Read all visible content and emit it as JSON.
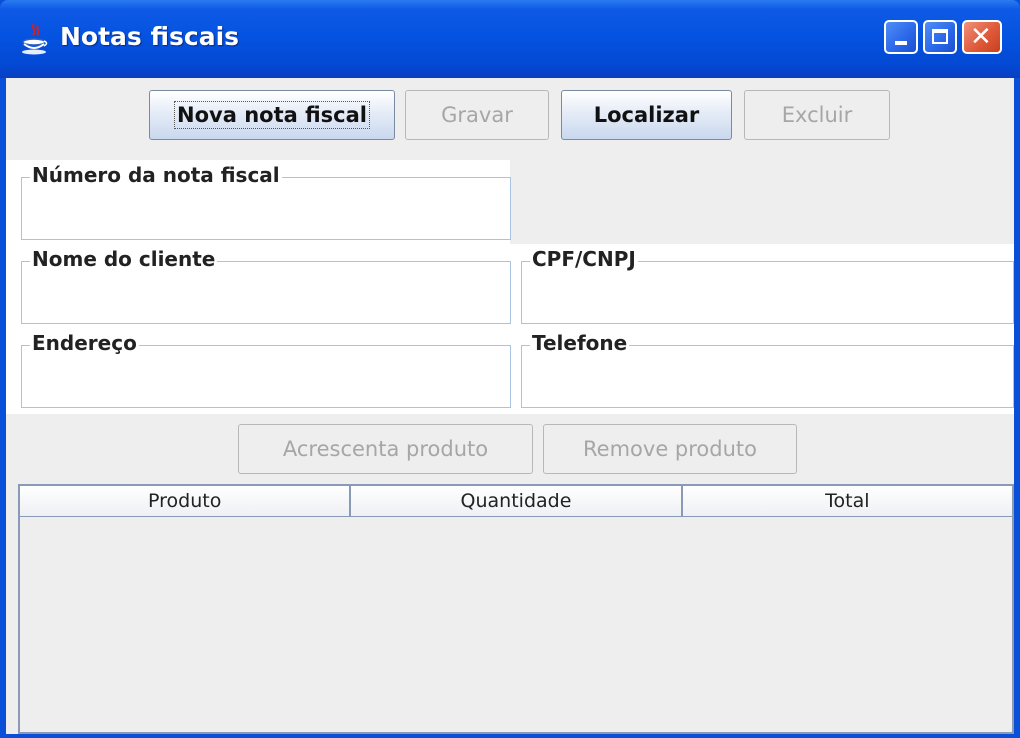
{
  "window": {
    "title": "Notas fiscais",
    "icon": "java-cup-icon"
  },
  "toolbar": {
    "new_label": "Nova nota fiscal",
    "save_label": "Gravar",
    "find_label": "Localizar",
    "delete_label": "Excluir"
  },
  "form": {
    "numero_label": "Número da nota fiscal",
    "numero_value": "",
    "cliente_label": "Nome do cliente",
    "cliente_value": "",
    "cpf_label": "CPF/CNPJ",
    "cpf_value": "",
    "endereco_label": "Endereço",
    "endereco_value": "",
    "telefone_label": "Telefone",
    "telefone_value": ""
  },
  "product_actions": {
    "add_label": "Acrescenta produto",
    "remove_label": "Remove produto"
  },
  "table": {
    "columns": [
      "Produto",
      "Quantidade",
      "Total"
    ],
    "rows": []
  },
  "colors": {
    "titlebar": "#0452e0",
    "panel": "#eeeeee",
    "field_border": "#a9c3e2"
  }
}
